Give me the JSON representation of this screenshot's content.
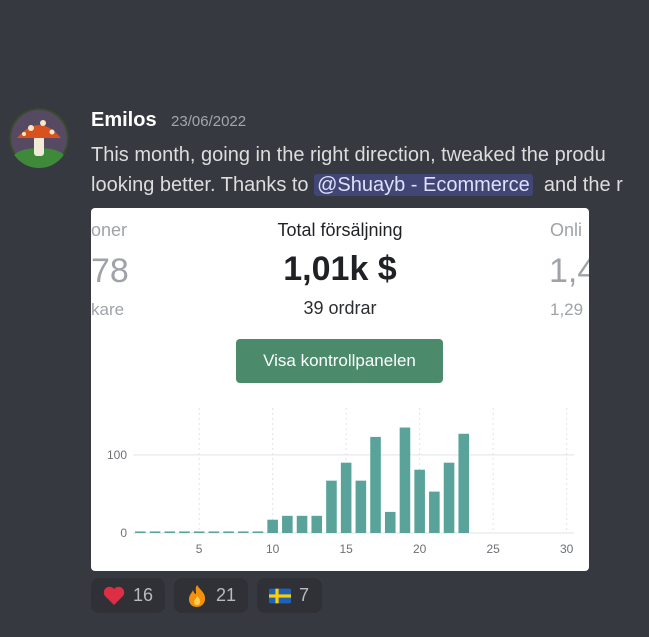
{
  "message": {
    "username": "Emilos",
    "timestamp": "23/06/2022",
    "line1": "This month, going in the right direction, tweaked the produ",
    "line2_before": "looking better. Thanks to ",
    "mention": "@Shuayb - Ecommerce",
    "line2_after": "  and the r"
  },
  "card": {
    "left_label": "oner",
    "left_value": "78",
    "left_sub": "kare",
    "title": "Total försäljning",
    "amount": "1,01k $",
    "orders": "39 ordrar",
    "button_label": "Visa kontrollpanelen",
    "right_label": "Onli",
    "right_value": "1,4",
    "right_sub": "1,29",
    "accent_color": "#4b8b6b",
    "bar_color": "#5aa39b"
  },
  "chart_data": {
    "type": "bar",
    "x": [
      1,
      2,
      3,
      4,
      5,
      6,
      7,
      8,
      9,
      10,
      11,
      12,
      13,
      14,
      15,
      16,
      17,
      18,
      19,
      20,
      21,
      22,
      23,
      24,
      25,
      26,
      27,
      28,
      29,
      30
    ],
    "values": [
      2,
      2,
      2,
      2,
      2,
      2,
      2,
      2,
      2,
      17,
      22,
      22,
      22,
      67,
      90,
      67,
      123,
      27,
      135,
      81,
      53,
      90,
      127,
      0,
      0,
      0,
      0,
      0,
      0,
      0
    ],
    "yticks": [
      "0",
      "100"
    ],
    "ytick_values": [
      0,
      100
    ],
    "xticks": [
      "5",
      "10",
      "15",
      "20",
      "25",
      "30"
    ],
    "xtick_values": [
      5,
      10,
      15,
      20,
      25,
      30
    ],
    "ylim": [
      0,
      160
    ],
    "xlim": [
      0.5,
      30.5
    ]
  },
  "reactions": [
    {
      "emoji": "heart-icon",
      "count": "16"
    },
    {
      "emoji": "fire-icon",
      "count": "21"
    },
    {
      "emoji": "swedish-flag-icon",
      "count": "7"
    }
  ]
}
